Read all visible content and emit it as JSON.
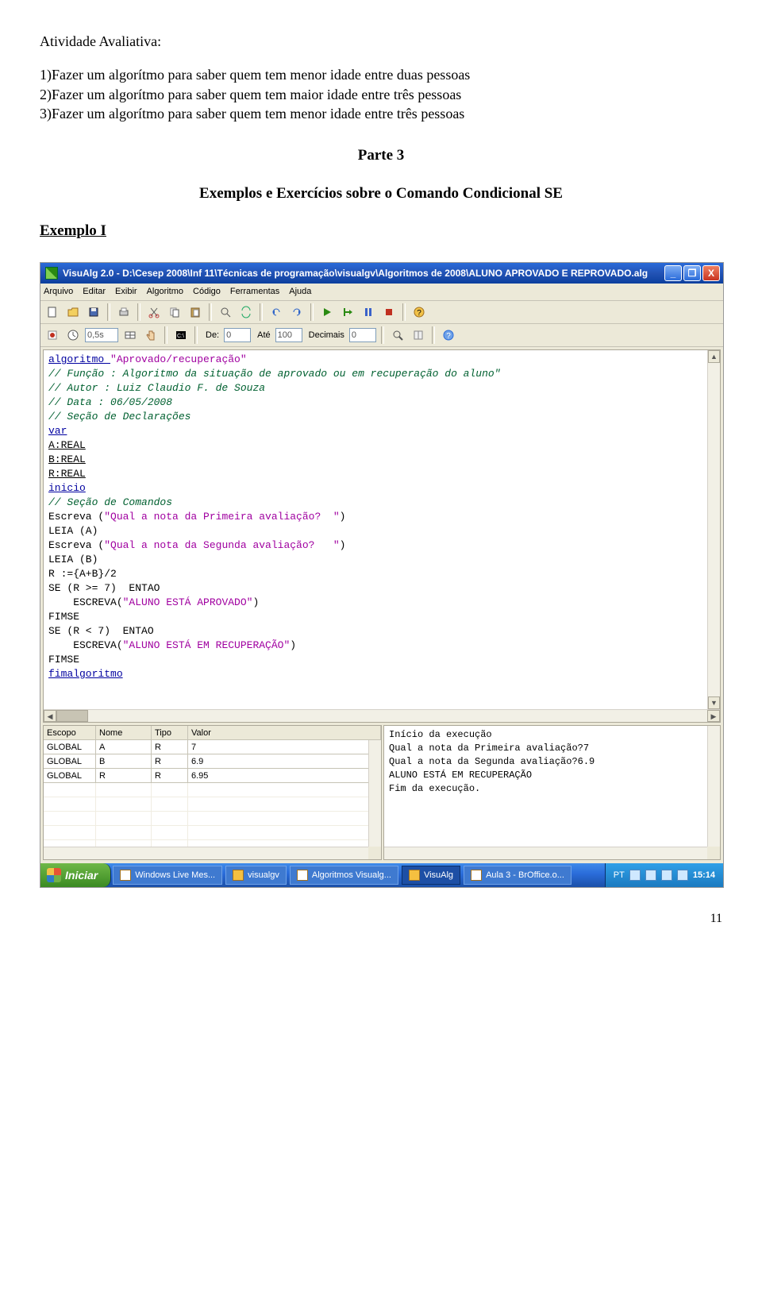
{
  "document": {
    "heading": "Atividade Avaliativa:",
    "items": [
      "1)Fazer um algorítmo para saber quem tem menor idade entre duas pessoas",
      "2)Fazer um algorítmo para saber quem tem maior idade entre três pessoas",
      "3)Fazer um algorítmo para saber quem tem menor idade entre três pessoas"
    ],
    "part_title": "Parte 3",
    "exercises_title": "Exemplos e Exercícios sobre o Comando Condicional SE",
    "example_title": "Exemplo I",
    "page_number": "11"
  },
  "window": {
    "title": "VisuAlg 2.0 - D:\\Cesep 2008\\Inf 11\\Técnicas de programação\\visualgv\\Algoritmos de 2008\\ALUNO APROVADO E REPROVADO.alg",
    "buttons": {
      "min": "_",
      "max": "❐",
      "close": "X"
    }
  },
  "menubar": {
    "items": [
      "Arquivo",
      "Editar",
      "Exibir",
      "Algoritmo",
      "Código",
      "Ferramentas",
      "Ajuda"
    ]
  },
  "toolbar2": {
    "time": "0,5s",
    "label_de": "De:",
    "val_de": "0",
    "label_ate": "Até",
    "val_ate": "100",
    "label_dec": "Decimais",
    "val_dec": "0"
  },
  "code": {
    "lines": [
      {
        "cls": "kw",
        "text": "algoritmo "
      },
      {
        "cls": "str",
        "text": "\"Aprovado/recuperação\""
      },
      {
        "br": true
      },
      {
        "cls": "cm",
        "text": "// Função : Algoritmo da situação de aprovado ou em recuperação do aluno\""
      },
      {
        "br": true
      },
      {
        "cls": "cm",
        "text": "// Autor : Luiz Claudio F. de Souza"
      },
      {
        "br": true
      },
      {
        "cls": "cm",
        "text": "// Data : 06/05/2008"
      },
      {
        "br": true
      },
      {
        "cls": "cm",
        "text": "// Seção de Declarações"
      },
      {
        "br": true
      },
      {
        "cls": "kw",
        "text": "var"
      },
      {
        "br": true
      },
      {
        "cls": "decl",
        "text": "A:REAL"
      },
      {
        "br": true
      },
      {
        "cls": "decl",
        "text": "B:REAL"
      },
      {
        "br": true
      },
      {
        "cls": "decl",
        "text": "R:REAL"
      },
      {
        "br": true
      },
      {
        "cls": "kw",
        "text": "inicio"
      },
      {
        "br": true
      },
      {
        "cls": "cm",
        "text": "// Seção de Comandos"
      },
      {
        "br": true
      },
      {
        "cls": "",
        "text": "Escreva ("
      },
      {
        "cls": "str",
        "text": "\"Qual a nota da Primeira avaliação?  \""
      },
      {
        "cls": "",
        "text": ")"
      },
      {
        "br": true
      },
      {
        "cls": "",
        "text": "LEIA (A)"
      },
      {
        "br": true
      },
      {
        "cls": "",
        "text": "Escreva ("
      },
      {
        "cls": "str",
        "text": "\"Qual a nota da Segunda avaliação?   \""
      },
      {
        "cls": "",
        "text": ")"
      },
      {
        "br": true
      },
      {
        "cls": "",
        "text": "LEIA (B)"
      },
      {
        "br": true
      },
      {
        "cls": "",
        "text": "R :={A+B}/2"
      },
      {
        "br": true
      },
      {
        "cls": "",
        "text": "SE (R >= 7)  ENTAO"
      },
      {
        "br": true
      },
      {
        "cls": "",
        "text": "    ESCREVA("
      },
      {
        "cls": "str",
        "text": "\"ALUNO ESTÁ APROVADO\""
      },
      {
        "cls": "",
        "text": ")"
      },
      {
        "br": true
      },
      {
        "cls": "",
        "text": "FIMSE"
      },
      {
        "br": true
      },
      {
        "cls": "",
        "text": "SE (R < 7)  ENTAO"
      },
      {
        "br": true
      },
      {
        "cls": "",
        "text": "    ESCREVA("
      },
      {
        "cls": "str",
        "text": "\"ALUNO ESTÁ EM RECUPERAÇÃO\""
      },
      {
        "cls": "",
        "text": ")"
      },
      {
        "br": true
      },
      {
        "cls": "",
        "text": "FIMSE"
      },
      {
        "br": true
      },
      {
        "cls": "kw",
        "text": "fimalgoritmo"
      },
      {
        "br": true
      }
    ]
  },
  "vars_grid": {
    "headers": {
      "scope": "Escopo",
      "name": "Nome",
      "type": "Tipo",
      "value": "Valor"
    },
    "rows": [
      {
        "scope": "GLOBAL",
        "name": "A",
        "type": "R",
        "value": "7"
      },
      {
        "scope": "GLOBAL",
        "name": "B",
        "type": "R",
        "value": "6.9"
      },
      {
        "scope": "GLOBAL",
        "name": "R",
        "type": "R",
        "value": "6.95"
      }
    ],
    "empty_rows": 5
  },
  "console": {
    "lines": [
      "Início da execução",
      "Qual a nota da Primeira avaliação?7",
      "Qual a nota da Segunda avaliação?6.9",
      "ALUNO ESTÁ EM RECUPERAÇÃO",
      "Fim da execução."
    ]
  },
  "taskbar": {
    "start": "Iniciar",
    "items": [
      {
        "label": "Windows Live Mes...",
        "active": false
      },
      {
        "label": "visualgv",
        "active": false
      },
      {
        "label": "Algoritmos Visualg...",
        "active": false
      },
      {
        "label": "VisuAlg",
        "active": true
      },
      {
        "label": "Aula 3 - BrOffice.o...",
        "active": false
      }
    ],
    "lang": "PT",
    "clock": "15:14"
  }
}
